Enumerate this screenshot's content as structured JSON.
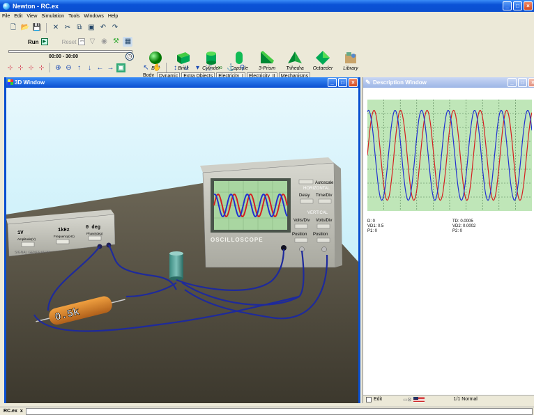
{
  "window": {
    "title": "Newton - RC.ex"
  },
  "menu": [
    "File",
    "Edit",
    "View",
    "Simulation",
    "Tools",
    "Windows",
    "Help"
  ],
  "sim": {
    "run_label": "Run",
    "reset_label": "Reset",
    "time_range": "00:00 - 30:00",
    "progress": 0.0
  },
  "shapes": [
    "Ball",
    "Brick",
    "Cylinder",
    "Capsule",
    "3-Prism",
    "Trihedra",
    "Octaeder",
    "Library"
  ],
  "tabs": [
    "Body",
    "Dynamic",
    "Extra Objects",
    "Electricity_I",
    "Electricity_II",
    "Mechanisms"
  ],
  "win3d": {
    "title": "3D Window"
  },
  "scene": {
    "generator": {
      "v": "1V",
      "freq": "1kHz",
      "phase": "0 deg",
      "amp": "Amplitude(V)",
      "freq_label": "Frequency(Hz)",
      "phase_label": "Phase(deg)",
      "name": "SIGNAL GENERATOR"
    },
    "scope": {
      "autoscale": "Autoscale",
      "horizontal": "HORIZONTAL",
      "delay": "Delay",
      "timediv": "Time/Div",
      "vertical": "VERTICAL",
      "voltsdiv1": "Volts/Div",
      "voltsdiv2": "Volts/Div",
      "position1": "Position",
      "position2": "Position",
      "name": "OSCILLOSCOPE"
    },
    "resistor": {
      "label": "0.5k"
    }
  },
  "desc": {
    "title": "Description Window",
    "readouts_left": [
      "D: 0",
      "VD1: 0.5",
      "P1: 0"
    ],
    "readouts_right": [
      "TD: 0.0005",
      "VD2: 0.0002",
      "P2: 0"
    ],
    "edit_label": "Edit",
    "zoom_label": "1/1 Normal"
  },
  "chart_data": {
    "type": "line",
    "grid": true,
    "series": [
      {
        "color": "#d42020",
        "periods": 6.2,
        "phase": 0.0,
        "amplitude": 0.85
      },
      {
        "color": "#2030d0",
        "periods": 6.2,
        "phase": 1.3,
        "amplitude": 0.85
      }
    ]
  },
  "statusbar": {
    "file_tab": "RC.ex",
    "close": "x"
  },
  "colors": {
    "title_blue": "#0a4fd0",
    "scene_top": "#c8f0fa",
    "floor": "#4a4538",
    "graph_bg": "#bfe6b8"
  }
}
